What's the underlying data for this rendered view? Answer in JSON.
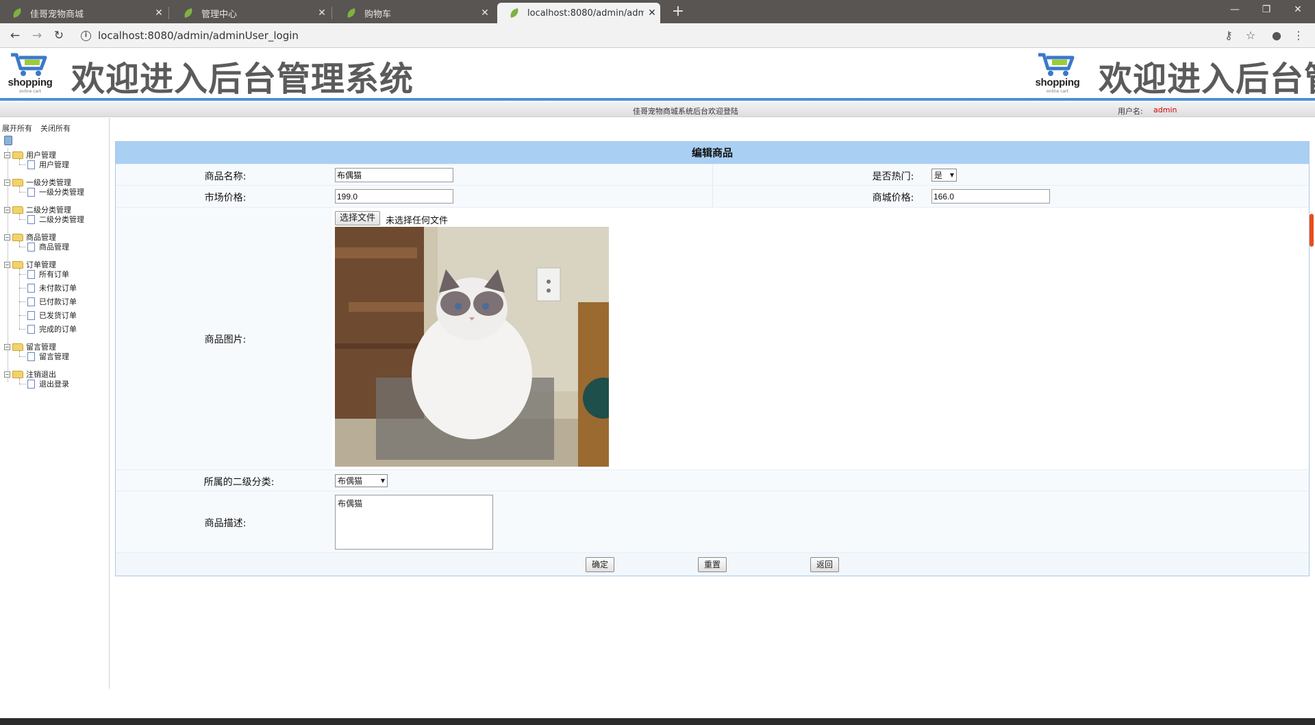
{
  "browser": {
    "tabs": [
      {
        "title": "佳哥宠物商城",
        "active": false
      },
      {
        "title": "管理中心",
        "active": false
      },
      {
        "title": "购物车",
        "active": false
      },
      {
        "title": "localhost:8080/admin/adminU",
        "active": true
      }
    ],
    "url": "localhost:8080/admin/adminUser_login"
  },
  "header": {
    "logo_text": "shopping",
    "logo_subtext": "online cart",
    "title": "欢迎进入后台管理系统",
    "welcome": "佳哥宠物商城系统后台欢迎登陆",
    "user_label": "用户名:",
    "username": "admin"
  },
  "tree": {
    "expand_all": "展开所有",
    "collapse_all": "关闭所有",
    "groups": [
      {
        "label": "用户管理",
        "items": [
          "用户管理"
        ]
      },
      {
        "label": "一级分类管理",
        "items": [
          "一级分类管理"
        ]
      },
      {
        "label": "二级分类管理",
        "items": [
          "二级分类管理"
        ]
      },
      {
        "label": "商品管理",
        "items": [
          "商品管理"
        ]
      },
      {
        "label": "订单管理",
        "items": [
          "所有订单",
          "未付款订单",
          "已付款订单",
          "已发货订单",
          "完成的订单"
        ]
      },
      {
        "label": "留言管理",
        "items": [
          "留言管理"
        ]
      },
      {
        "label": "注销退出",
        "items": [
          "退出登录"
        ]
      }
    ]
  },
  "form": {
    "title": "编辑商品",
    "name_label": "商品名称:",
    "name_value": "布偶猫",
    "hot_label": "是否热门:",
    "hot_value": "是",
    "market_price_label": "市场价格:",
    "market_price_value": "199.0",
    "shop_price_label": "商城价格:",
    "shop_price_value": "166.0",
    "image_label": "商品图片:",
    "file_button": "选择文件",
    "file_status": "未选择任何文件",
    "category_label": "所属的二级分类:",
    "category_value": "布偶猫",
    "desc_label": "商品描述:",
    "desc_value": "布偶猫",
    "buttons": {
      "confirm": "确定",
      "reset": "重置",
      "back": "返回"
    }
  },
  "colors": {
    "accent": "#4a90d9",
    "form_header": "#a9cff3",
    "username": "#d40000"
  }
}
